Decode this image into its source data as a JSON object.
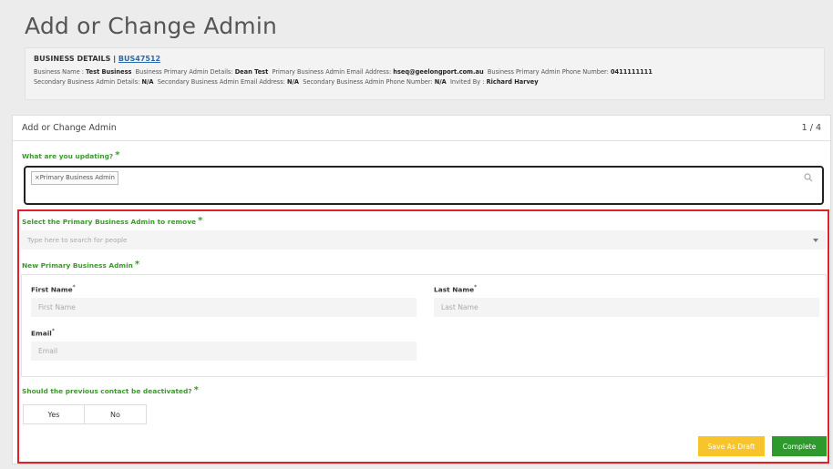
{
  "page": {
    "title": "Add or Change Admin"
  },
  "business": {
    "heading": "BUSINESS DETAILS |",
    "id_link": "BUS47512",
    "line1": [
      {
        "label": "Business Name : ",
        "value": "Test Business"
      },
      {
        "label": "Business Primary Admin Details: ",
        "value": "Dean Test"
      },
      {
        "label": "Primary Business Admin Email Address: ",
        "value": "hseq@geelongport.com.au"
      },
      {
        "label": "Business Primary Admin Phone Number: ",
        "value": "0411111111"
      }
    ],
    "line2": [
      {
        "label": "Secondary Business Admin Details: ",
        "value": "N/A"
      },
      {
        "label": "Secondary Business Admin Email Address: ",
        "value": "N/A"
      },
      {
        "label": "Secondary Business Admin Phone Number: ",
        "value": "N/A"
      },
      {
        "label": "Invited By : ",
        "value": "Richard Harvey"
      }
    ]
  },
  "form": {
    "title": "Add or Change Admin",
    "step": "1 / 4",
    "q_updating": "What are you updating?",
    "required_mark": "*",
    "selected_tag": "×Primary Business Admin",
    "q_remove": "Select the Primary Business Admin to remove",
    "people_placeholder": "Type here to search for people",
    "q_new_admin": "New Primary Business Admin",
    "first_name_label": "First Name",
    "first_name_placeholder": "First Name",
    "last_name_label": "Last Name",
    "last_name_placeholder": "Last Name",
    "email_label": "Email",
    "email_placeholder": "Email",
    "field_req": "*",
    "q_deactivate": "Should the previous contact be deactivated?",
    "yes_label": "Yes",
    "no_label": "No",
    "save_draft_label": "Save As Draft",
    "complete_label": "Complete"
  },
  "colors": {
    "accent_green": "#3a9a2a",
    "highlight_red": "#e0202a",
    "draft_yellow": "#f7c52b",
    "complete_green": "#2e9a2e"
  },
  "icons": {
    "search": "search-icon",
    "dropdown": "chevron-down-icon"
  }
}
